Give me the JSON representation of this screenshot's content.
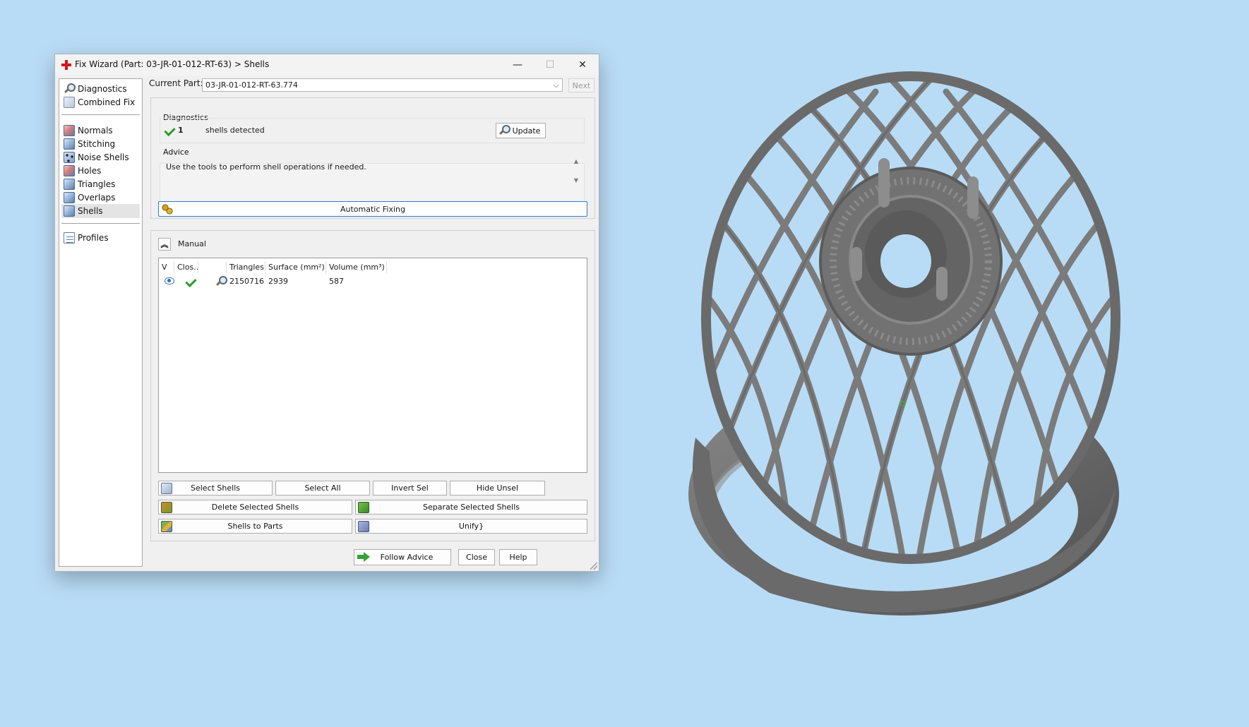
{
  "window": {
    "title": "Fix Wizard (Part: 03-JR-01-012-RT-63) > Shells",
    "minimize_glyph": "—",
    "maximize_glyph": "☐",
    "close_glyph": "✕"
  },
  "nav": {
    "top_items": [
      {
        "label": "Diagnostics",
        "icon": "magnifier-icon"
      },
      {
        "label": "Combined Fix",
        "icon": "combined-fix-icon"
      }
    ],
    "fix_items": [
      {
        "label": "Normals",
        "icon": "normals-icon"
      },
      {
        "label": "Stitching",
        "icon": "stitching-icon"
      },
      {
        "label": "Noise Shells",
        "icon": "noise-shells-icon"
      },
      {
        "label": "Holes",
        "icon": "holes-icon"
      },
      {
        "label": "Triangles",
        "icon": "triangles-icon"
      },
      {
        "label": "Overlaps",
        "icon": "overlaps-icon"
      },
      {
        "label": "Shells",
        "icon": "shells-icon",
        "selected": true
      }
    ],
    "bottom_items": [
      {
        "label": "Profiles",
        "icon": "profiles-icon"
      }
    ]
  },
  "current_part": {
    "label": "Current Part:",
    "value": "03-JR-01-012-RT-63.774",
    "next_label": "Next"
  },
  "diagnostics": {
    "title": "Diagnostics",
    "count": "1",
    "description": "shells detected",
    "update_label": "Update"
  },
  "advice": {
    "title": "Advice",
    "text": "Use the tools to perform shell operations if needed.",
    "scroll_up": "▲",
    "scroll_down": "▼"
  },
  "automatic_fixing_label": "Automatic Fixing",
  "manual": {
    "collapse_glyph": "︽",
    "title": "Manual",
    "columns": [
      "V",
      "Clos...",
      "",
      "Triangles",
      "Surface (mm²)",
      "Volume (mm³)"
    ],
    "rows": [
      {
        "visible": "eye-icon",
        "closed": "check-icon",
        "tool": "magnifier-icon",
        "triangles": "2150716",
        "surface": "2939",
        "volume": "587"
      }
    ],
    "buttons": {
      "select_shells": "Select Shells",
      "select_all": "Select All",
      "invert_sel": "Invert Sel",
      "hide_unsel": "Hide Unsel",
      "delete_selected": "Delete Selected Shells",
      "separate_selected": "Separate Selected Shells",
      "shells_to_parts": "Shells to Parts",
      "unify": "Unify"
    }
  },
  "footer": {
    "follow_advice": "Follow Advice",
    "close": "Close",
    "help": "Help"
  },
  "colors": {
    "desktop_background": "#b9dcf6",
    "model_gray": "#7d7d7d",
    "check_green": "#2e9a2e",
    "focus_blue": "#2b7bd3"
  }
}
